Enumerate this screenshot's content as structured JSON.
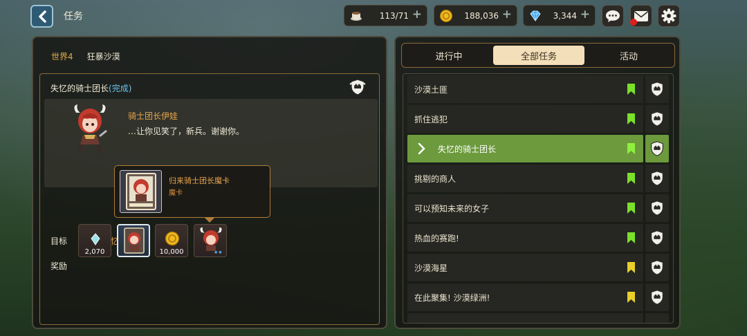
{
  "header": {
    "title": "任务",
    "stamina": "113/71",
    "gold": "188,036",
    "gems": "3,344"
  },
  "left": {
    "world": "世界4",
    "region": "狂暴沙漠",
    "quest_title": "失忆的骑士团长",
    "quest_status": "(完成)",
    "npc_name": "骑士团长伊娃",
    "npc_line": "…让你见笑了，新兵。谢谢你。",
    "goal_label": "目标",
    "goal_value": "恢复记忆",
    "reward_label": "奖励",
    "rewards": [
      {
        "icon": "crystal-icon",
        "count": "2,070"
      },
      {
        "icon": "card-icon",
        "count": ""
      },
      {
        "icon": "gold-coin-icon",
        "count": "10,000"
      },
      {
        "icon": "character-icon",
        "count": ""
      }
    ],
    "tooltip": {
      "title": "归来骑士团长魔卡",
      "subtitle": "魔卡"
    }
  },
  "right": {
    "tabs": [
      "进行中",
      "全部任务",
      "活动"
    ],
    "active_tab": 1,
    "quests": [
      {
        "name": "沙漠土匪",
        "flag": "green"
      },
      {
        "name": "抓住逃犯",
        "flag": "green"
      },
      {
        "name": "失忆的骑士团长",
        "flag": "green",
        "selected": true
      },
      {
        "name": "挑剔的商人",
        "flag": "green"
      },
      {
        "name": "可以预知未来的女子",
        "flag": "green"
      },
      {
        "name": "热血的赛跑!",
        "flag": "green"
      },
      {
        "name": "沙漠海星",
        "flag": "yellow"
      },
      {
        "name": "在此聚集! 沙漠绿洲!",
        "flag": "yellow"
      }
    ]
  },
  "colors": {
    "accent_orange": "#e8a64e",
    "complete_blue": "#6cc3f0",
    "selected_green": "#6c9a3d",
    "flag_green": "#7be02a",
    "flag_yellow": "#e8cf2a",
    "tab_active": "#f3dfb9"
  }
}
